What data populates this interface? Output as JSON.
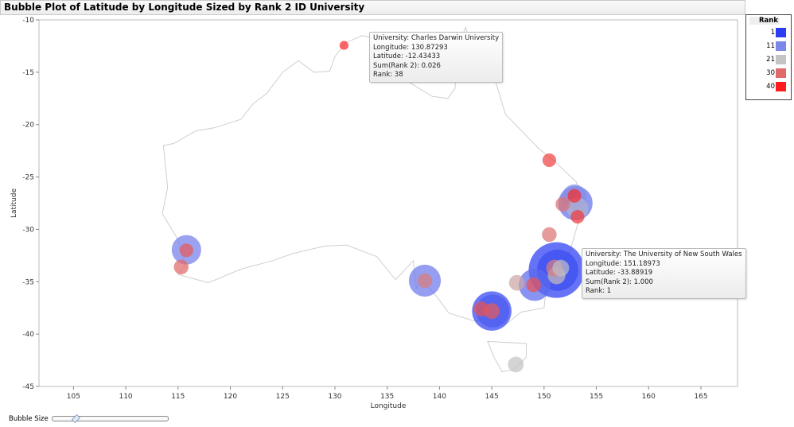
{
  "title": "Bubble Plot of Latitude by Longitude Sized by Rank 2 ID University",
  "chart_data": {
    "type": "scatter",
    "subtype": "bubble",
    "title": "Bubble Plot of Latitude by Longitude Sized by Rank 2 ID University",
    "xlabel": "Longitude",
    "ylabel": "Latitude",
    "xlim": [
      101.7,
      168.5
    ],
    "ylim": [
      -45,
      -10
    ],
    "xticks": [
      105,
      110,
      115,
      120,
      125,
      130,
      135,
      140,
      145,
      150,
      155,
      160,
      165
    ],
    "yticks": [
      -10,
      -15,
      -20,
      -25,
      -30,
      -35,
      -40,
      -45
    ],
    "legend": {
      "title": "Rank",
      "position": "top-right",
      "entries": [
        {
          "label": "1",
          "color": "#2b3df2"
        },
        {
          "label": "11",
          "color": "#7c87ea"
        },
        {
          "label": "21",
          "color": "#c4c4c4"
        },
        {
          "label": "30",
          "color": "#e06a6a"
        },
        {
          "label": "40",
          "color": "#ff1c1c"
        }
      ]
    },
    "points": [
      {
        "lon": 151.19,
        "lat": -33.89,
        "size": 1.0,
        "rank": 1
      },
      {
        "lon": 151.3,
        "lat": -33.9,
        "size": 0.55,
        "rank": 3
      },
      {
        "lon": 145.0,
        "lat": -37.8,
        "size": 0.5,
        "rank": 2
      },
      {
        "lon": 145.1,
        "lat": -37.8,
        "size": 0.35,
        "rank": 5
      },
      {
        "lon": 153.0,
        "lat": -27.5,
        "size": 0.38,
        "rank": 8
      },
      {
        "lon": 152.9,
        "lat": -26.9,
        "size": 0.2,
        "rank": 12
      },
      {
        "lon": 153.2,
        "lat": -28.0,
        "size": 0.15,
        "rank": 18
      },
      {
        "lon": 149.1,
        "lat": -35.3,
        "size": 0.33,
        "rank": 7
      },
      {
        "lon": 138.6,
        "lat": -34.9,
        "size": 0.33,
        "rank": 9
      },
      {
        "lon": 115.8,
        "lat": -31.95,
        "size": 0.28,
        "rank": 10
      },
      {
        "lon": 151.0,
        "lat": -33.7,
        "size": 0.09,
        "rank": 28
      },
      {
        "lon": 151.2,
        "lat": -34.4,
        "size": 0.1,
        "rank": 22
      },
      {
        "lon": 151.6,
        "lat": -33.7,
        "size": 0.09,
        "rank": 20
      },
      {
        "lon": 145.0,
        "lat": -37.8,
        "size": 0.08,
        "rank": 32
      },
      {
        "lon": 144.0,
        "lat": -37.6,
        "size": 0.07,
        "rank": 33
      },
      {
        "lon": 149.0,
        "lat": -35.3,
        "size": 0.07,
        "rank": 33
      },
      {
        "lon": 147.4,
        "lat": -35.1,
        "size": 0.08,
        "rank": 24
      },
      {
        "lon": 138.6,
        "lat": -34.9,
        "size": 0.07,
        "rank": 28
      },
      {
        "lon": 115.8,
        "lat": -32.0,
        "size": 0.06,
        "rank": 32
      },
      {
        "lon": 115.3,
        "lat": -33.6,
        "size": 0.07,
        "rank": 30
      },
      {
        "lon": 152.9,
        "lat": -26.8,
        "size": 0.06,
        "rank": 38
      },
      {
        "lon": 151.8,
        "lat": -27.6,
        "size": 0.07,
        "rank": 29
      },
      {
        "lon": 153.2,
        "lat": -28.8,
        "size": 0.06,
        "rank": 36
      },
      {
        "lon": 150.5,
        "lat": -30.5,
        "size": 0.07,
        "rank": 29
      },
      {
        "lon": 150.5,
        "lat": -23.4,
        "size": 0.06,
        "rank": 35
      },
      {
        "lon": 147.3,
        "lat": -42.9,
        "size": 0.08,
        "rank": 21
      },
      {
        "lon": 130.87293,
        "lat": -12.43433,
        "size": 0.026,
        "rank": 38
      }
    ],
    "tooltips": [
      {
        "lines": [
          "University: Charles Darwin University",
          "Longitude: 130.87293",
          "Latitude: -12.43433",
          "Sum(Rank 2): 0.026",
          "Rank: 38"
        ]
      },
      {
        "lines": [
          "University: The University of New South Wales",
          "Longitude: 151.18973",
          "Latitude: -33.88919",
          "Sum(Rank 2): 1.000",
          "Rank: 1"
        ]
      }
    ]
  },
  "controls": {
    "bubble_size_label": "Bubble Size",
    "bubble_size_value": 0.2
  }
}
